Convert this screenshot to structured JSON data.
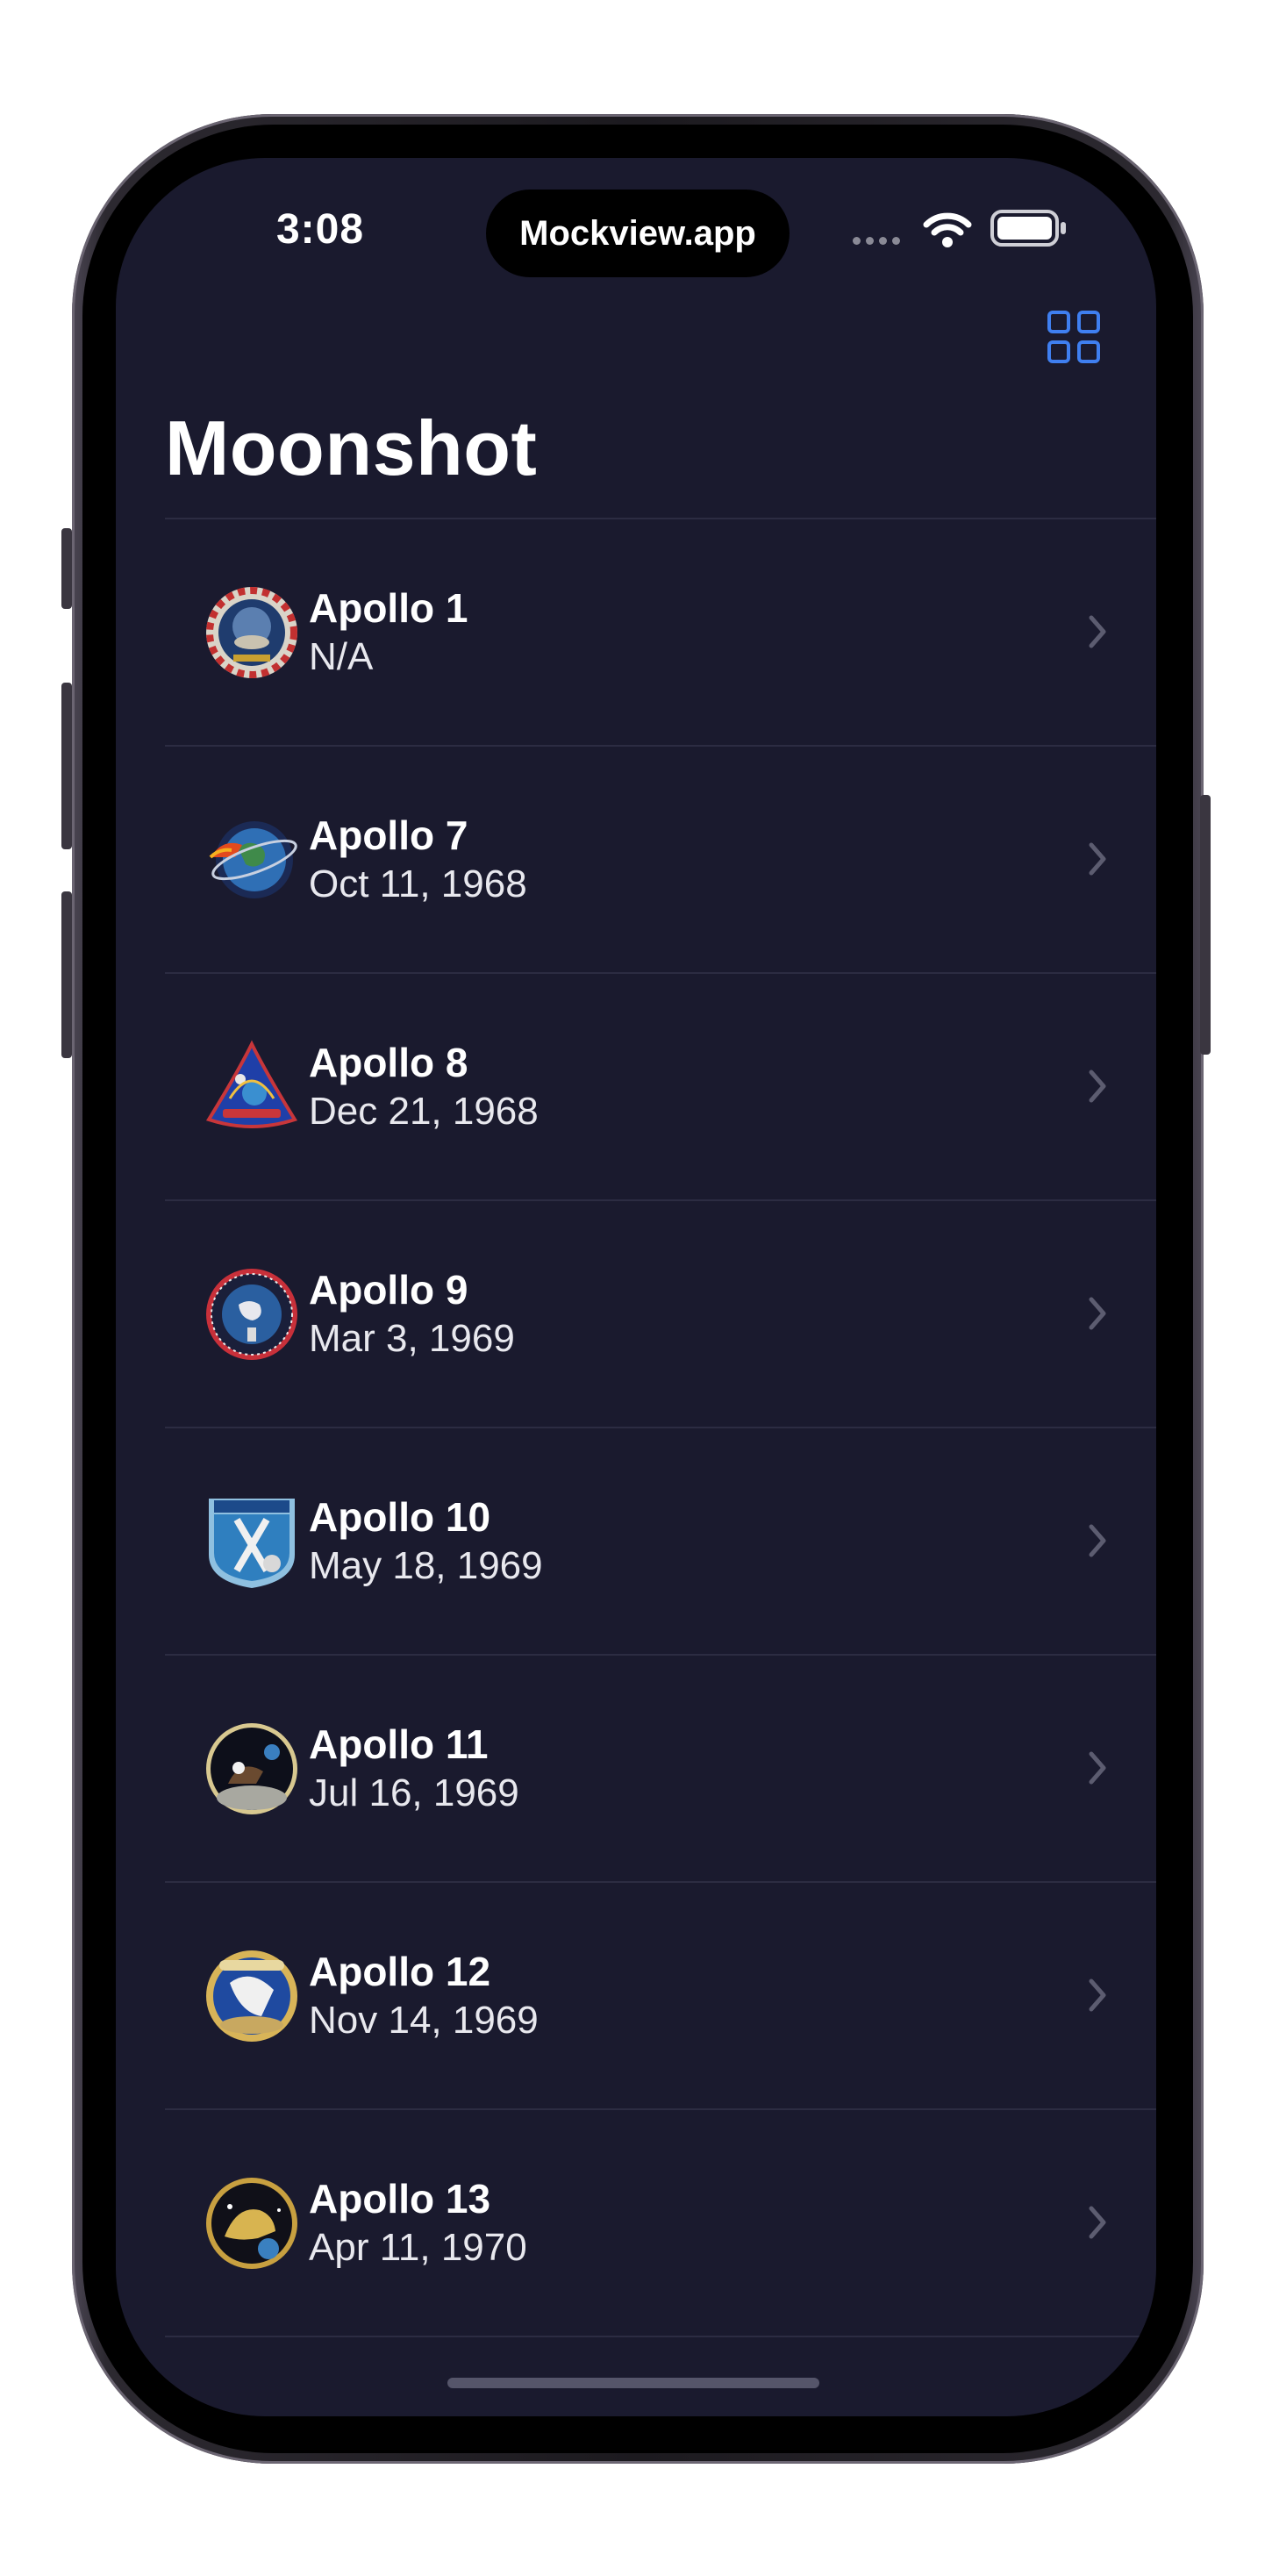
{
  "status_bar": {
    "time": "3:08",
    "island_label": "Mockview.app",
    "wifi_icon": "wifi-icon",
    "battery_icon": "battery-icon"
  },
  "nav": {
    "title": "Moonshot",
    "layout_toggle_icon": "grid-icon",
    "accent_color": "#3f7ff0"
  },
  "missions": [
    {
      "name": "Apollo 1",
      "date": "N/A",
      "badge_icon": "apollo-1-badge-icon"
    },
    {
      "name": "Apollo 7",
      "date": "Oct 11, 1968",
      "badge_icon": "apollo-7-badge-icon"
    },
    {
      "name": "Apollo 8",
      "date": "Dec 21, 1968",
      "badge_icon": "apollo-8-badge-icon"
    },
    {
      "name": "Apollo 9",
      "date": "Mar 3, 1969",
      "badge_icon": "apollo-9-badge-icon"
    },
    {
      "name": "Apollo 10",
      "date": "May 18, 1969",
      "badge_icon": "apollo-10-badge-icon"
    },
    {
      "name": "Apollo 11",
      "date": "Jul 16, 1969",
      "badge_icon": "apollo-11-badge-icon"
    },
    {
      "name": "Apollo 12",
      "date": "Nov 14, 1969",
      "badge_icon": "apollo-12-badge-icon"
    },
    {
      "name": "Apollo 13",
      "date": "Apr 11, 1970",
      "badge_icon": "apollo-13-badge-icon"
    }
  ],
  "colors": {
    "background": "#1a1a2e",
    "separator": "#2c2c42"
  }
}
